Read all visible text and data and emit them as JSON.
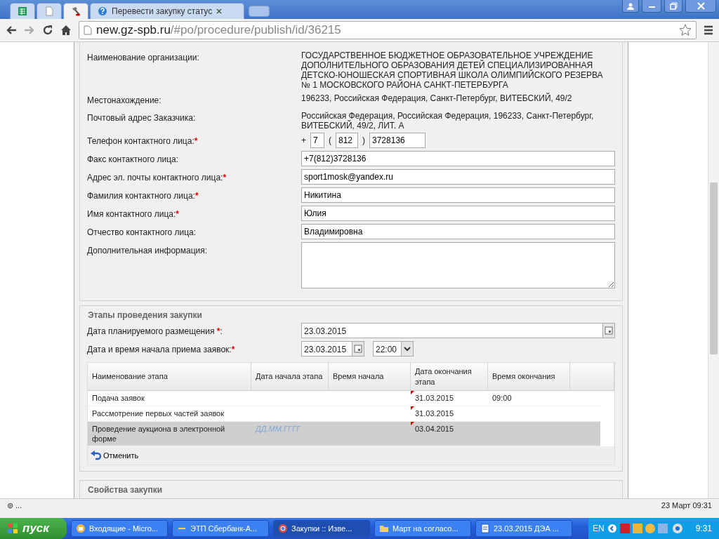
{
  "browser": {
    "tabs": [
      {
        "kind": "sheet",
        "selected": false
      },
      {
        "kind": "page",
        "selected": false
      },
      {
        "kind": "tool",
        "selected": true
      },
      {
        "kind": "help",
        "label": "Перевести закупку статус",
        "selected": false
      }
    ],
    "address": {
      "host": "new.gz-spb.ru",
      "path": "/#po/procedure/publish/id/36215"
    }
  },
  "customer": {
    "fields": [
      {
        "kind": "text",
        "label": "Наименование организации:",
        "required": false,
        "value": "ГОСУДАРСТВЕННОЕ БЮДЖЕТНОЕ ОБРАЗОВАТЕЛЬНОЕ УЧРЕЖДЕНИЕ ДОПОЛНИТЕЛЬНОГО ОБРАЗОВАНИЯ ДЕТЕЙ СПЕЦИАЛИЗИРОВАННАЯ ДЕТСКО-ЮНОШЕСКАЯ СПОРТИВНАЯ ШКОЛА ОЛИМПИЙСКОГО РЕЗЕРВА № 1 МОСКОВСКОГО РАЙОНА САНКТ-ПЕТЕРБУРГА"
      },
      {
        "kind": "text",
        "label": "Местонахождение:",
        "required": false,
        "value": "196233, Российская Федерация, Санкт-Петербург, ВИТЕБСКИЙ, 49/2"
      },
      {
        "kind": "text",
        "label": "Почтовый адрес Заказчика:",
        "required": false,
        "value": "Российская Федерация, Российская Федерация, 196233, Санкт-Петербург, ВИТЕБСКИЙ, 49/2, ЛИТ. А"
      },
      {
        "kind": "phone",
        "label": "Телефон контактного лица:",
        "required": true,
        "plus": "+",
        "country": "7",
        "open": "(",
        "code": "812",
        "close": ")",
        "number": "3728136"
      },
      {
        "kind": "input",
        "label": "Факс контактного лица:",
        "required": false,
        "value": "+7(812)3728136"
      },
      {
        "kind": "input",
        "label": "Адрес эл. почты контактного лица:",
        "required": true,
        "value": "sport1mosk@yandex.ru"
      },
      {
        "kind": "input",
        "label": "Фамилия контактного лица:",
        "required": true,
        "value": "Никитина"
      },
      {
        "kind": "input",
        "label": "Имя контактного лица:",
        "required": true,
        "value": "Юлия"
      },
      {
        "kind": "input",
        "label": "Отчество контактного лица:",
        "required": false,
        "value": "Владимировна"
      },
      {
        "kind": "textarea",
        "label": "Дополнительная информация:",
        "required": false
      }
    ]
  },
  "required_mark": "*",
  "stages": {
    "title": "Этапы проведения закупки",
    "planned": {
      "label": "Дата планируемого размещения ",
      "required_suffix": ":",
      "value": "23.03.2015"
    },
    "start": {
      "label": "Дата и время начала приема заявок:",
      "date": "23.03.2015",
      "time": "22:00"
    },
    "table": {
      "columns": [
        "Наименование этапа",
        "Дата начала этапа",
        "Время начала",
        "Дата окончания этапа",
        "Время окончания"
      ],
      "rows": [
        {
          "cells": [
            "Подача заявок",
            "",
            "",
            "31.03.2015",
            "09:00"
          ],
          "selected": false
        },
        {
          "cells": [
            "Рассмотрение первых частей заявок",
            "",
            "",
            "31.03.2015",
            ""
          ],
          "selected": false
        },
        {
          "cells": [
            "Проведение аукциона в электронной форме",
            "",
            "",
            "03.04.2015",
            ""
          ],
          "selected": true,
          "start_placeholder": "ДД.ММ.ГГГГ"
        }
      ]
    },
    "cancel": "Отменить"
  },
  "properties": {
    "title": "Свойства закупки"
  },
  "status_bar": {
    "left": "⊚ ...",
    "right": "23 Март 09:31"
  },
  "taskbar": {
    "start": "пуск",
    "items": [
      {
        "kind": "mail",
        "label": "Входящие - Micro...",
        "selected": false
      },
      {
        "kind": "ie",
        "label": "ЭТП Сбербанк-А...",
        "selected": false
      },
      {
        "kind": "chrome",
        "label": "Закупки :: Изве...",
        "selected": true
      },
      {
        "kind": "folder",
        "label": "Март на согласо...",
        "selected": false
      },
      {
        "kind": "doc",
        "label": "23.03.2015 ДЭА ...",
        "selected": false
      }
    ],
    "lang": "EN",
    "clock": "9:31"
  }
}
